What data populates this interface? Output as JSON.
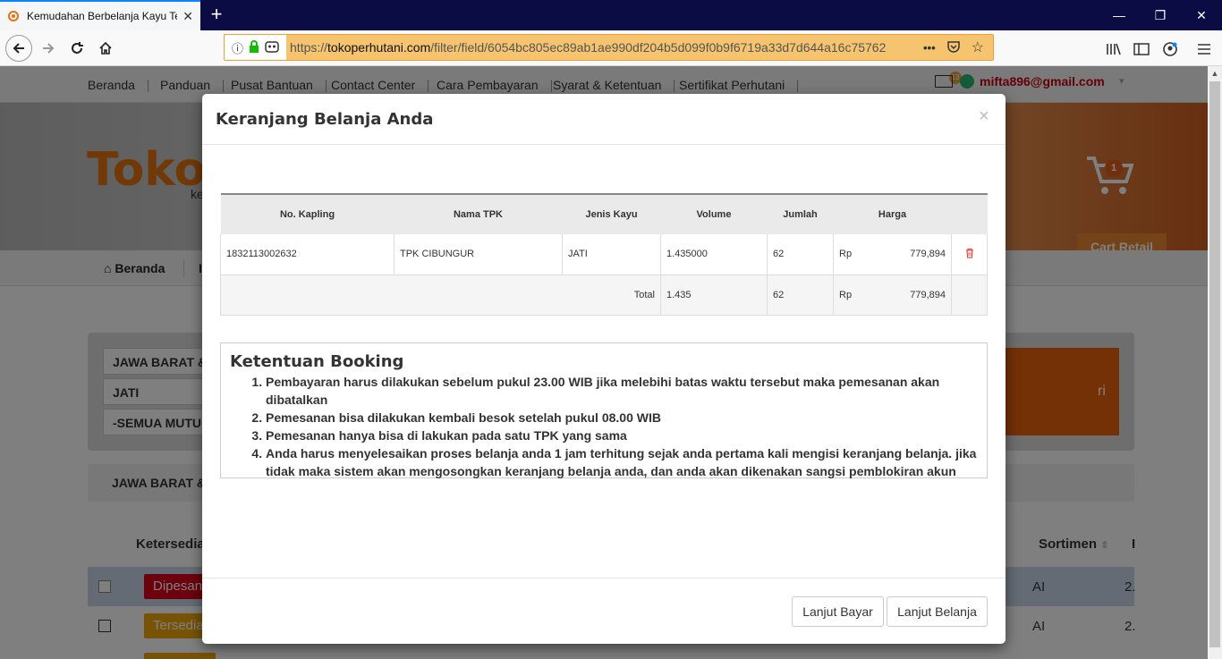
{
  "browser": {
    "tab_title": "Kemudahan Berbelanja Kayu Te",
    "new_tab": "+",
    "url_scheme": "https://",
    "url_domain": "tokoperhutani.com",
    "url_path": "/filter/field/6054bc805ec89ab1ae990df204b5d099f0b9f6719a33d7d644a16c75762",
    "more": "•••"
  },
  "site": {
    "topmenu": [
      "Beranda",
      "Panduan",
      "Pusat Bantuan",
      "Contact Center",
      "Cara Pembayaran",
      "Syarat & Ketentuan",
      "Sertifikat Perhutani"
    ],
    "notif_count": "13",
    "user_email": "mifta896@gmail.com",
    "logo": "Toko",
    "logo_sub": "ke",
    "cart_count": "1",
    "cart_button": "Cart Retail",
    "nav_home": "Beranda",
    "nav_next": "I",
    "filters": [
      "JAWA BARAT &",
      "JATI",
      "-SEMUA MUTU"
    ],
    "orange_button": "ri",
    "summary": "JAWA BARAT &",
    "headers_under": {
      "ketersediaan": "Ketersedia",
      "sortimen": "Sortimen",
      "partial": "I"
    },
    "rows_under": [
      {
        "status": "Dipesan",
        "sortimen": "AI",
        "value": "2."
      },
      {
        "status": "Tersedia",
        "sortimen": "AI",
        "value": "2."
      }
    ]
  },
  "modal": {
    "title": "Keranjang Belanja Anda",
    "close": "×",
    "table": {
      "headers": [
        "No. Kapling",
        "Nama TPK",
        "Jenis Kayu",
        "Volume",
        "Jumlah",
        "Harga"
      ],
      "rows": [
        {
          "no_kapling": "1832113002632",
          "nama_tpk": "TPK CIBUNGUR",
          "jenis_kayu": "JATI",
          "volume": "1.435000",
          "jumlah": "62",
          "currency": "Rp",
          "harga": "779,894"
        }
      ],
      "total": {
        "label": "Total",
        "volume": "1.435",
        "jumlah": "62",
        "currency": "Rp",
        "harga": "779,894"
      }
    },
    "ketentuan": {
      "title": "Ketentuan Booking",
      "items": [
        "Pembayaran harus dilakukan sebelum pukul 23.00 WIB jika melebihi batas waktu tersebut maka pemesanan akan dibatalkan",
        "Pemesanan bisa dilakukan kembali besok setelah pukul 08.00 WIB",
        "Pemesanan hanya bisa di lakukan pada satu TPK yang sama",
        "Anda harus menyelesaikan proses belanja anda 1 jam terhitung sejak anda pertama kali mengisi keranjang belanja. jika tidak maka sistem akan mengosongkan keranjang belanja anda, dan anda akan dikenakan sangsi pemblokiran akun"
      ]
    },
    "buttons": {
      "lanjut_bayar": "Lanjut Bayar",
      "lanjut_belanja": "Lanjut Belanja"
    }
  }
}
